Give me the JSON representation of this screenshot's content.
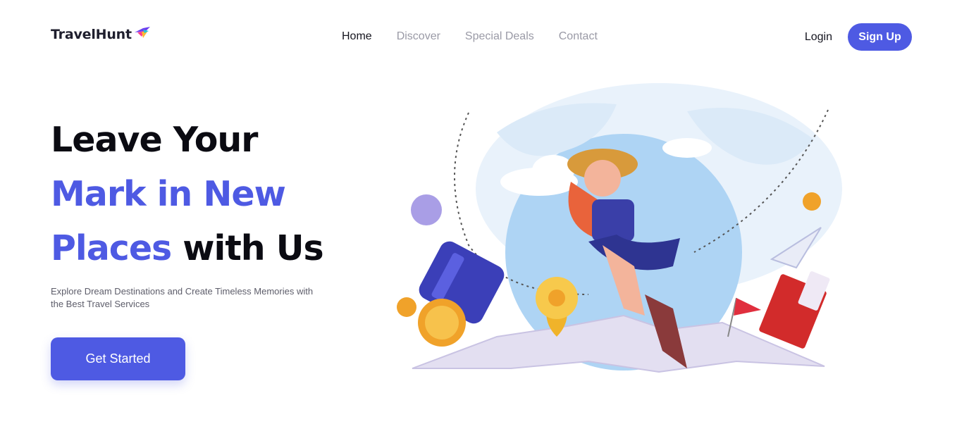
{
  "header": {
    "logo_text": "TravelHunt",
    "logo_icon": "bird-icon",
    "nav": [
      {
        "label": "Home",
        "active": true
      },
      {
        "label": "Discover",
        "active": false
      },
      {
        "label": "Special Deals",
        "active": false
      },
      {
        "label": "Contact",
        "active": false
      }
    ],
    "login_label": "Login",
    "signup_label": "Sign Up"
  },
  "hero": {
    "title_line1": "Leave Your",
    "title_line2": "Mark in New",
    "title_line3_accent": "Places",
    "title_line3_rest": " with Us",
    "subtitle": "Explore Dream Destinations and Create Timeless Memories with the Best Travel Services",
    "cta_label": "Get Started"
  },
  "colors": {
    "accent": "#4e5ae3",
    "text_dark": "#0b0b12",
    "nav_inactive": "#9a9aa6"
  },
  "illustration": {
    "description_icons": [
      "globe-icon",
      "traveler-girl-icon",
      "suitcase-icon",
      "map-icon",
      "location-pin-icon",
      "coin-icon",
      "paper-plane-icon",
      "passport-icon",
      "flag-icon",
      "planet-icon",
      "cloud-icon"
    ]
  }
}
